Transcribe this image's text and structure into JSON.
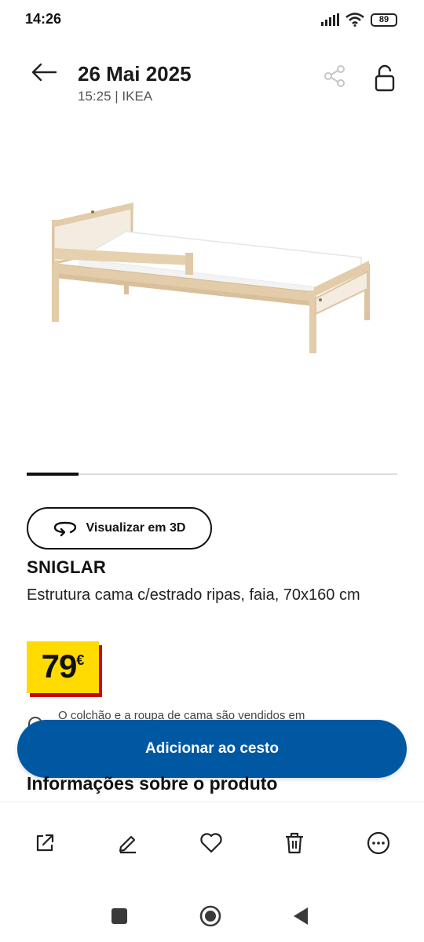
{
  "status_bar": {
    "time": "14:26",
    "battery": "89",
    "icons": [
      "signal-icon",
      "wifi-icon",
      "battery-icon"
    ]
  },
  "header": {
    "date": "26 Mai 2025",
    "subtitle": "15:25 | IKEA",
    "icons": [
      "back-arrow-icon",
      "share-icon",
      "unlock-icon"
    ]
  },
  "carousel": {
    "progress": 0.14
  },
  "product": {
    "view_3d_label": "Visualizar em 3D",
    "name": "SNIGLAR",
    "description": "Estrutura cama c/estrado ripas, faia, 70x160 cm",
    "price": "79",
    "currency": "€",
    "note": "O colchão e a roupa de cama são vendidos em",
    "add_to_cart": "Adicionar ao cesto",
    "info_title": "Informações sobre o produto"
  },
  "actions": [
    "open-external-icon",
    "edit-icon",
    "favorite-icon",
    "delete-icon",
    "more-icon"
  ],
  "colors": {
    "primary_button": "#0058a3",
    "price_tag": "#ffdb00",
    "price_shadow": "#cc0008"
  }
}
